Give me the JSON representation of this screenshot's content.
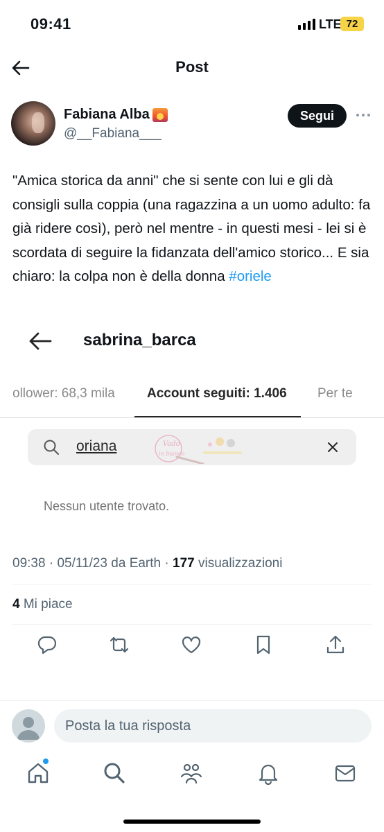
{
  "status_bar": {
    "time": "09:41",
    "network": "LTE",
    "battery": "72"
  },
  "header": {
    "title": "Post"
  },
  "author": {
    "name": "Fabiana Alba",
    "handle": "@__Fabiana___",
    "follow_label": "Segui"
  },
  "tweet": {
    "text": "\"Amica storica da anni\" che si sente con lui e gli dà consigli sulla coppia (una ragazzina a un uomo adulto: fa già ridere così), però nel mentre - in questi mesi - lei si è scordata di seguire la fidanzata dell'amico storico... E sia chiaro: la colpa non è della donna ",
    "hashtag": "#oriele"
  },
  "embedded": {
    "username": "sabrina_barca",
    "tabs": [
      {
        "label": "ollower: 68,3 mila"
      },
      {
        "label": "Account seguiti: 1.406"
      },
      {
        "label": "Per te"
      }
    ],
    "search_value": "oriana",
    "empty_message": "Nessun utente trovato.",
    "watermark_text": "Vado in bianco"
  },
  "meta": {
    "time": "09:38",
    "date": "05/11/23",
    "source": "da Earth",
    "views": "177",
    "views_label": "visualizzazioni",
    "likes": "4",
    "likes_label": "Mi piace"
  },
  "reply": {
    "placeholder": "Posta la tua risposta"
  },
  "icons": {
    "actions": [
      "reply-icon",
      "retweet-icon",
      "like-icon",
      "bookmark-icon",
      "share-icon"
    ],
    "tabs": [
      "home-icon",
      "search-icon",
      "communities-icon",
      "notifications-icon",
      "messages-icon"
    ]
  },
  "colors": {
    "accent": "#1d9bf0",
    "text": "#0f1419",
    "muted": "#536471",
    "battery": "#f7d347"
  }
}
